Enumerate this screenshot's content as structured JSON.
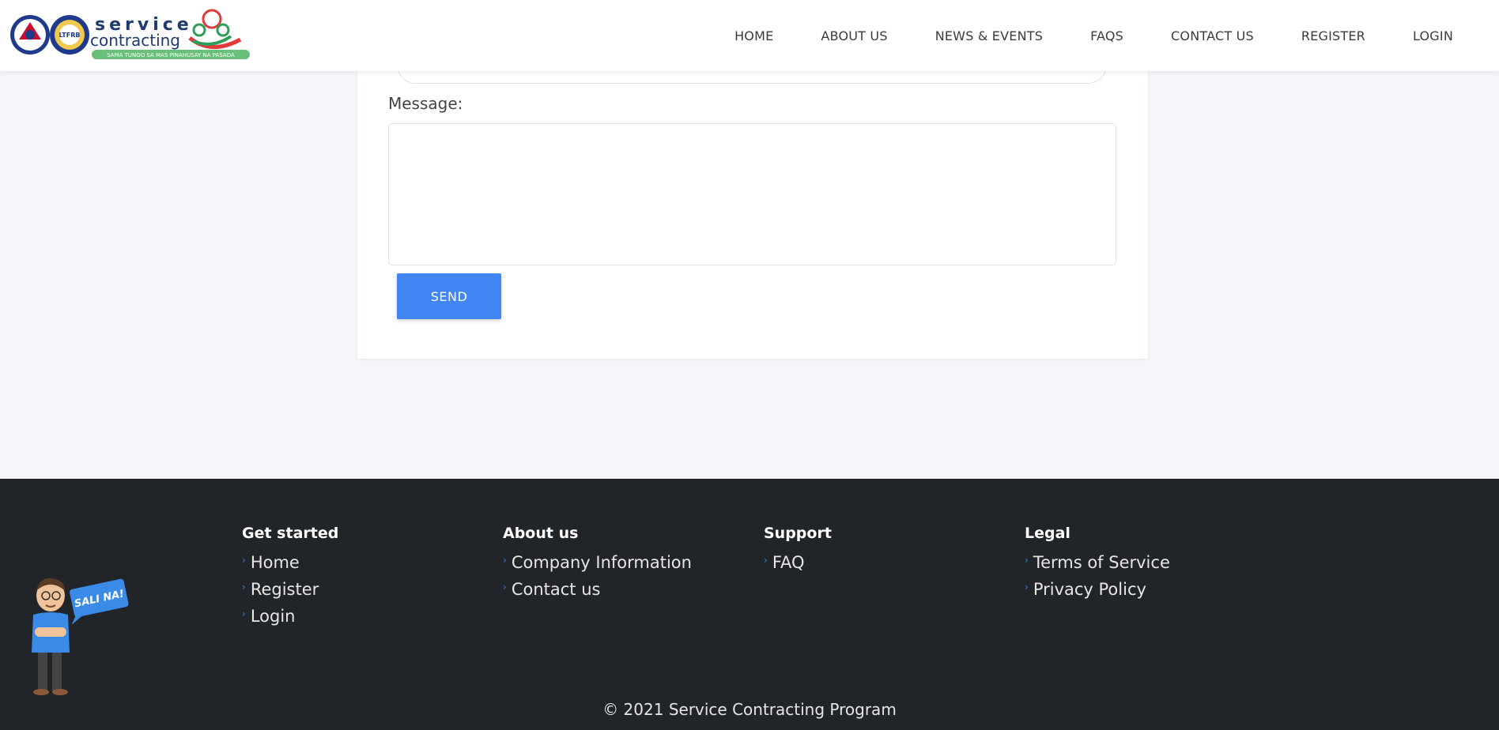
{
  "header": {
    "logo": {
      "brand_line1": "service",
      "brand_line2": "contracting",
      "tagline": "SAMA TUNGO SA MAS PINAHUSAY NA PASADA",
      "seal2_text": "LTFRB"
    },
    "nav": [
      "HOME",
      "ABOUT US",
      "NEWS & EVENTS",
      "FAQS",
      "CONTACT US",
      "REGISTER",
      "LOGIN"
    ]
  },
  "form": {
    "message_label": "Message:",
    "message_value": "",
    "send_label": "SEND"
  },
  "footer": {
    "columns": [
      {
        "title": "Get started",
        "links": [
          "Home",
          "Register",
          "Login"
        ]
      },
      {
        "title": "About us",
        "links": [
          "Company Information",
          "Contact us"
        ]
      },
      {
        "title": "Support",
        "links": [
          "FAQ"
        ]
      },
      {
        "title": "Legal",
        "links": [
          "Terms of Service",
          "Privacy Policy"
        ]
      }
    ],
    "mascot_bubble": "SALI NA!",
    "copyright": "© 2021 Service Contracting Program"
  },
  "colors": {
    "accent": "#4285f4",
    "footer_bg": "#212529",
    "page_bg": "#f5f6fa",
    "link_chevron": "#2f80ed"
  }
}
